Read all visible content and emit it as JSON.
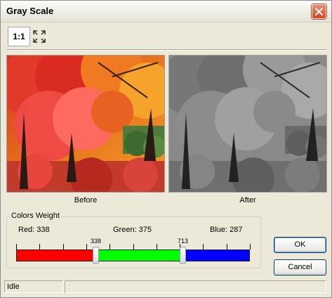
{
  "window": {
    "title": "Gray Scale",
    "close_icon": "close-x-icon"
  },
  "toolbar": {
    "actual_size_label": "1:1",
    "fit_icon": "fit-to-window-icon"
  },
  "previews": {
    "before_caption": "Before",
    "after_caption": "After"
  },
  "colors_weight": {
    "group_title": "Colors Weight",
    "red_label": "Red: 338",
    "green_label": "Green: 375",
    "blue_label": "Blue: 287",
    "thumb1_value_label": "338",
    "thumb2_value_label": "713",
    "total": 1000,
    "thumb1_value": 338,
    "thumb2_value": 713,
    "colors": {
      "red": "#ff0000",
      "green": "#00ff00",
      "blue": "#0000ff"
    }
  },
  "buttons": {
    "ok": "OK",
    "cancel": "Cancel"
  },
  "status": {
    "text": "Idle"
  }
}
